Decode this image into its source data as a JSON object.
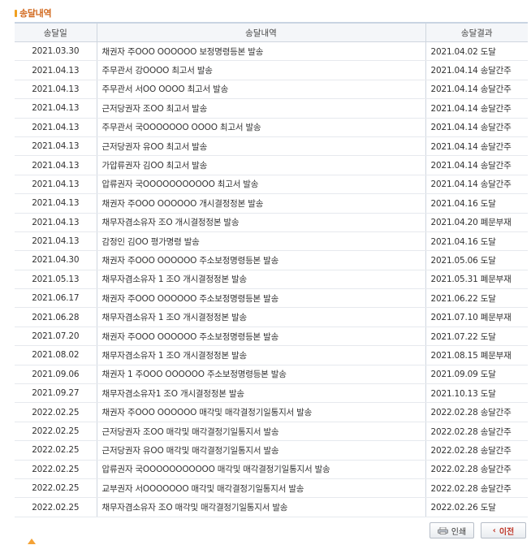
{
  "section": {
    "title": "송달내역"
  },
  "table": {
    "headers": [
      "송달일",
      "송달내역",
      "송달결과"
    ],
    "rows": [
      [
        "2021.03.30",
        "채권자 주OOO OOOOOO 보정명령등본 발송",
        "2021.04.02 도달"
      ],
      [
        "2021.04.13",
        "주무관서 강OOOO 최고서 발송",
        "2021.04.14 송달간주"
      ],
      [
        "2021.04.13",
        "주무관서 서OO OOOO 최고서 발송",
        "2021.04.14 송달간주"
      ],
      [
        "2021.04.13",
        "근저당권자 조OO 최고서 발송",
        "2021.04.14 송달간주"
      ],
      [
        "2021.04.13",
        "주무관서 국OOOOOOO OOOO 최고서 발송",
        "2021.04.14 송달간주"
      ],
      [
        "2021.04.13",
        "근저당권자 유OO 최고서 발송",
        "2021.04.14 송달간주"
      ],
      [
        "2021.04.13",
        "가압류권자 김OO 최고서 발송",
        "2021.04.14 송달간주"
      ],
      [
        "2021.04.13",
        "압류권자 국OOOOOOOOOOO 최고서 발송",
        "2021.04.14 송달간주"
      ],
      [
        "2021.04.13",
        "채권자 주OOO OOOOOO 개시결정정본 발송",
        "2021.04.16 도달"
      ],
      [
        "2021.04.13",
        "채무자겸소유자 조O 개시결정정본 발송",
        "2021.04.20 폐문부재"
      ],
      [
        "2021.04.13",
        "감정인 김OO 평가명령 발송",
        "2021.04.16 도달"
      ],
      [
        "2021.04.30",
        "채권자 주OOO OOOOOO 주소보정명령등본 발송",
        "2021.05.06 도달"
      ],
      [
        "2021.05.13",
        "채무자겸소유자 1 조O 개시결정정본 발송",
        "2021.05.31 폐문부재"
      ],
      [
        "2021.06.17",
        "채권자 주OOO OOOOOO 주소보정명령등본 발송",
        "2021.06.22 도달"
      ],
      [
        "2021.06.28",
        "채무자겸소유자 1 조O 개시결정정본 발송",
        "2021.07.10 폐문부재"
      ],
      [
        "2021.07.20",
        "채권자 주OOO OOOOOO 주소보정명령등본 발송",
        "2021.07.22 도달"
      ],
      [
        "2021.08.02",
        "채무자겸소유자 1 조O 개시결정정본 발송",
        "2021.08.15 폐문부재"
      ],
      [
        "2021.09.06",
        "채권자 1 주OOO OOOOOO 주소보정명령등본 발송",
        "2021.09.09 도달"
      ],
      [
        "2021.09.27",
        "채무자겸소유자1 조O 개시결정정본 발송",
        "2021.10.13 도달"
      ],
      [
        "2022.02.25",
        "채권자 주OOO OOOOOO 매각및 매각결정기일통지서 발송",
        "2022.02.28 송달간주"
      ],
      [
        "2022.02.25",
        "근저당권자 조OO 매각및 매각결정기일통지서 발송",
        "2022.02.28 송달간주"
      ],
      [
        "2022.02.25",
        "근저당권자 유OO 매각및 매각결정기일통지서 발송",
        "2022.02.28 송달간주"
      ],
      [
        "2022.02.25",
        "압류권자 국OOOOOOOOOOO 매각및 매각결정기일통지서 발송",
        "2022.02.28 송달간주"
      ],
      [
        "2022.02.25",
        "교부권자 서OOOOOOO 매각및 매각결정기일통지서 발송",
        "2022.02.28 송달간주"
      ],
      [
        "2022.02.25",
        "채무자겸소유자 조O 매각및 매각결정기일통지서 발송",
        "2022.02.26 도달"
      ]
    ]
  },
  "buttons": {
    "print_label": "인쇄",
    "prev_label": "이전"
  },
  "icons": {
    "title_bullet": "orange-bar-icon",
    "print": "printer-icon",
    "prev": "chevron-left-icon"
  },
  "colors": {
    "title": "#d2691e",
    "bullet": "#f0a020",
    "header_bg": "#f4f6f9",
    "prev_text": "#c0392b"
  }
}
